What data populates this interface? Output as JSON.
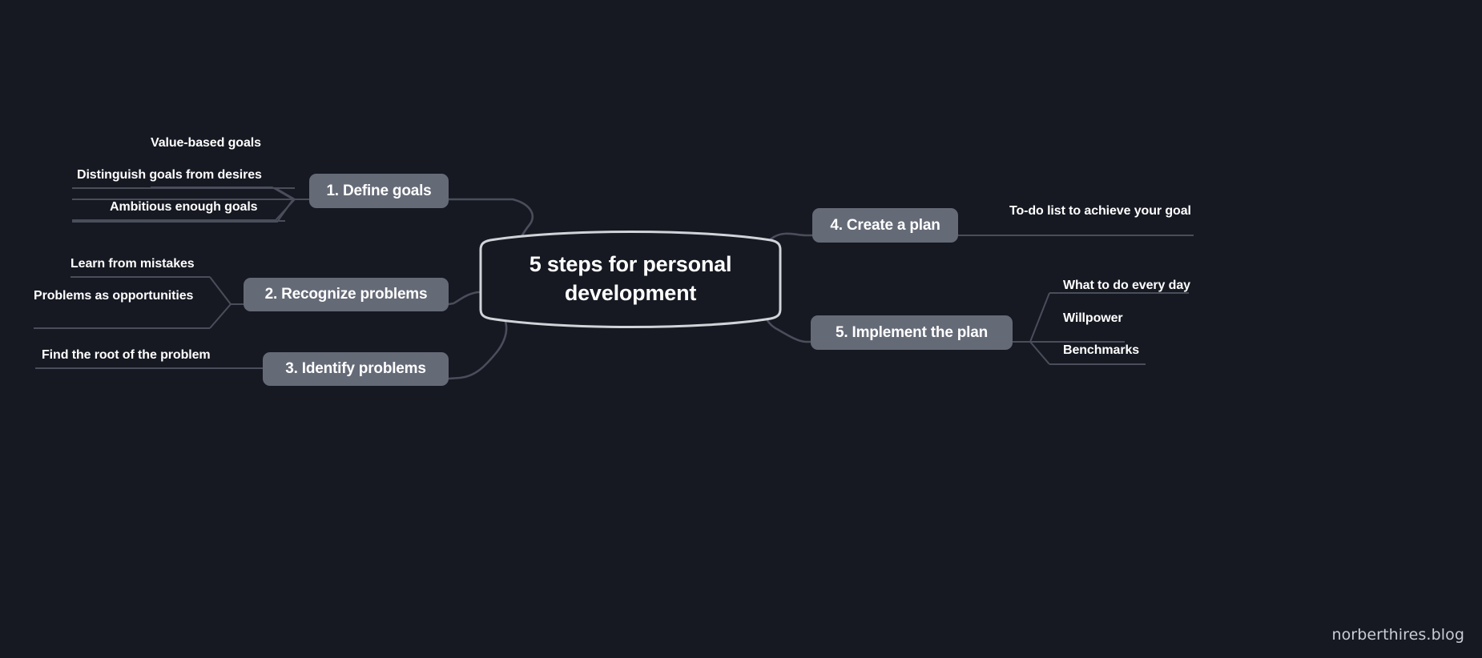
{
  "diagram": {
    "title": "5 steps for personal development",
    "center": {
      "label": "5 steps for personal development"
    },
    "branches": [
      {
        "id": "define-goals",
        "label": "1. Define goals",
        "side": "left",
        "leaves": [
          {
            "label": "Value-based goals"
          },
          {
            "label": "Distinguish goals from desires"
          },
          {
            "label": "Ambitious enough goals"
          }
        ]
      },
      {
        "id": "recognize-problems",
        "label": "2. Recognize problems",
        "side": "left",
        "leaves": [
          {
            "label": "Learn from mistakes"
          },
          {
            "label": "Problems as opportunities"
          }
        ]
      },
      {
        "id": "identify-problems",
        "label": "3. Identify problems",
        "side": "left",
        "leaves": [
          {
            "label": "Find the root of the problem"
          }
        ]
      },
      {
        "id": "create-a-plan",
        "label": "4. Create a plan",
        "side": "right",
        "leaves": [
          {
            "label": "To-do list to achieve your goal"
          }
        ]
      },
      {
        "id": "implement-the-plan",
        "label": "5. Implement the plan",
        "side": "right",
        "leaves": [
          {
            "label": "What to do every day"
          },
          {
            "label": "Willpower"
          },
          {
            "label": "Benchmarks"
          }
        ]
      }
    ]
  },
  "watermark": {
    "text": "norberthires.blog"
  },
  "colors": {
    "background": "#161922",
    "node_fill": "#656a77",
    "node_text": "#ffffff",
    "center_stroke": "#d0d3d8",
    "connector": "#4a4e5a",
    "leaf_text": "#ffffff",
    "watermark_text": "#c9ccd4"
  }
}
